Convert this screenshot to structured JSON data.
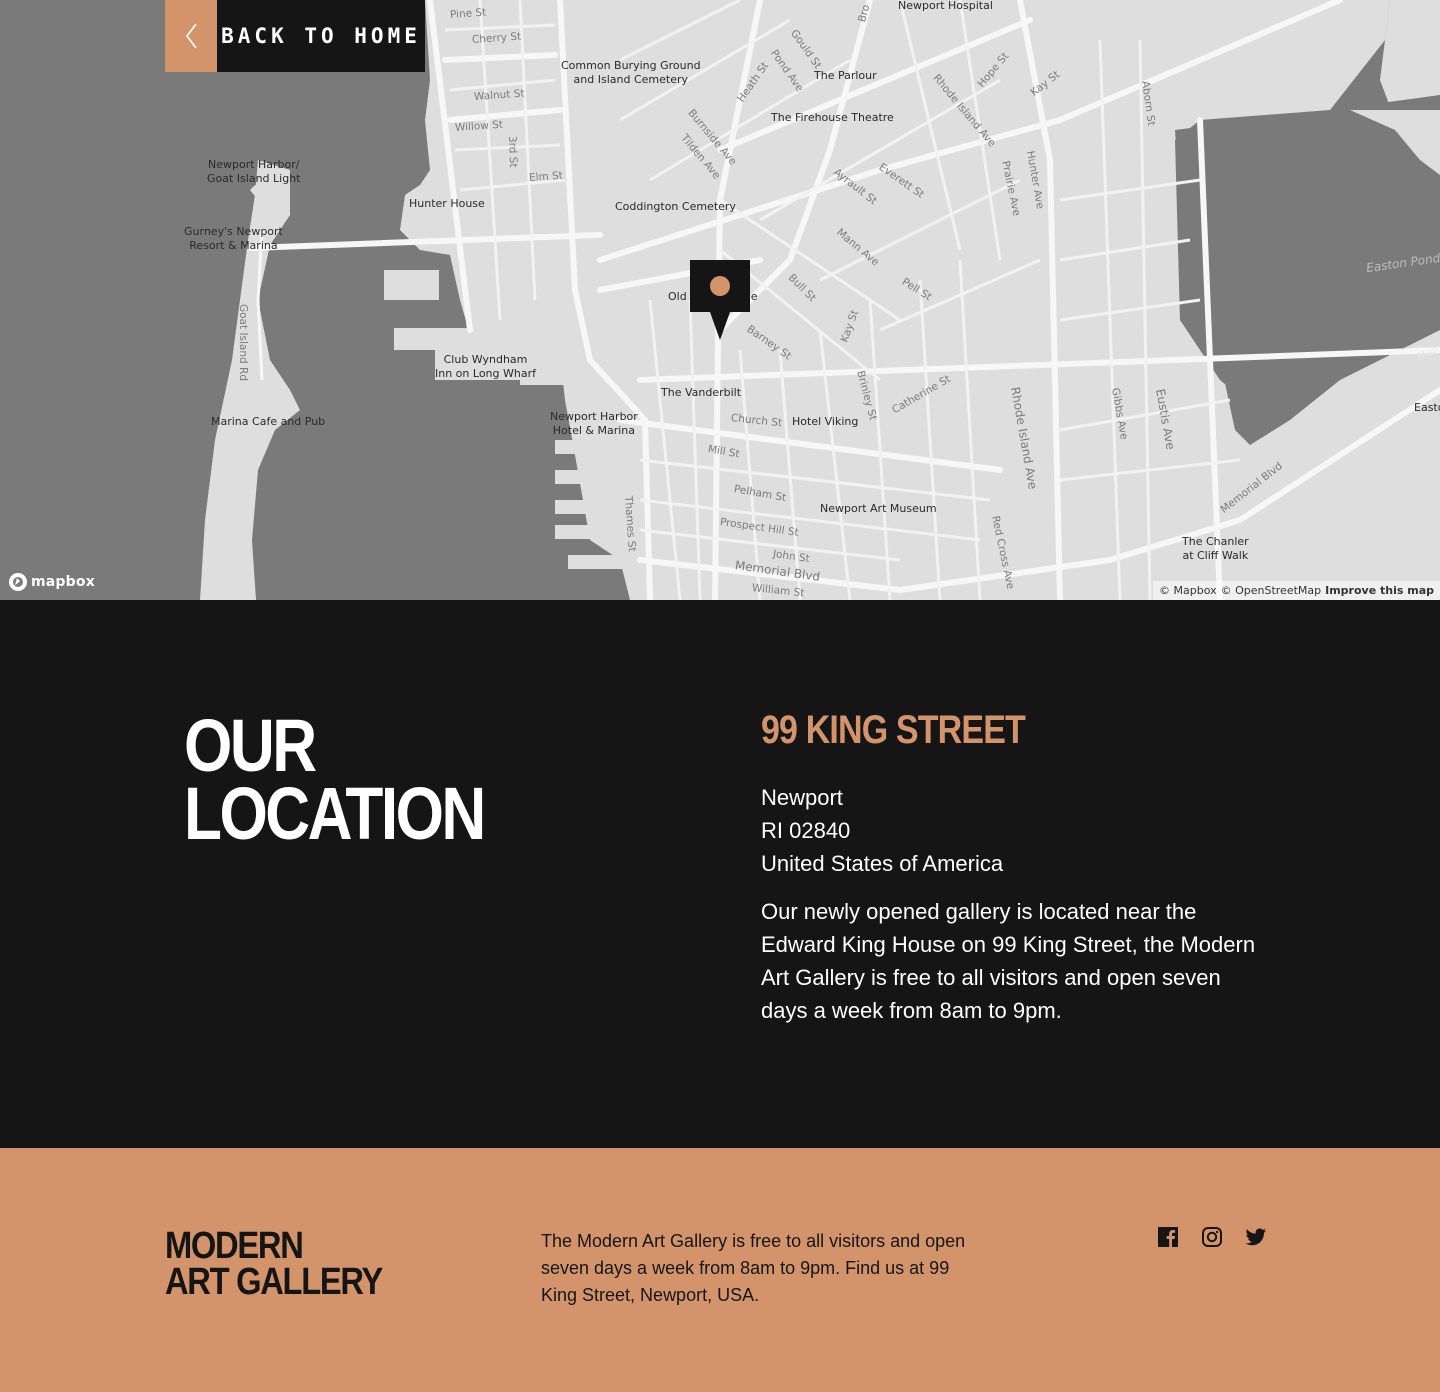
{
  "nav": {
    "back_label": "BACK TO HOME"
  },
  "map": {
    "attribution": {
      "mapbox": "© Mapbox",
      "osm": "© OpenStreetMap",
      "improve": "Improve this map"
    },
    "logo_text": "mapbox",
    "places": [
      {
        "name": "Newport Hospital"
      },
      {
        "name": "Common Burying Ground\nand Island Cemetery"
      },
      {
        "name": "The Parlour"
      },
      {
        "name": "The Firehouse Theatre"
      },
      {
        "name": "Newport Harbor/\nGoat Island Light"
      },
      {
        "name": "Hunter House"
      },
      {
        "name": "Coddington Cemetery"
      },
      {
        "name": "Gurney's Newport\nResort & Marina"
      },
      {
        "name": "Old C"
      },
      {
        "name": "se"
      },
      {
        "name": "Club Wyndham\nInn on Long Wharf"
      },
      {
        "name": "The Vanderbilt"
      },
      {
        "name": "Marina Cafe and Pub"
      },
      {
        "name": "Newport Harbor\nHotel & Marina"
      },
      {
        "name": "Hotel Viking"
      },
      {
        "name": "Newport Art Museum"
      },
      {
        "name": "The Chanler\nat Cliff Walk"
      },
      {
        "name": "Easto"
      }
    ],
    "streets": [
      {
        "name": "Pine St"
      },
      {
        "name": "Cherry St"
      },
      {
        "name": "Walnut St"
      },
      {
        "name": "Willow St"
      },
      {
        "name": "3rd St"
      },
      {
        "name": "Elm St"
      },
      {
        "name": "Goat Island Rd"
      },
      {
        "name": "Thames St"
      },
      {
        "name": "Church St"
      },
      {
        "name": "Mill St"
      },
      {
        "name": "Pelham St"
      },
      {
        "name": "Prospect Hill St"
      },
      {
        "name": "John St"
      },
      {
        "name": "Memorial Blvd"
      },
      {
        "name": "William St"
      },
      {
        "name": "Barney St"
      },
      {
        "name": "Bull St"
      },
      {
        "name": "Mann Ave"
      },
      {
        "name": "Ayrault St"
      },
      {
        "name": "Everett St"
      },
      {
        "name": "Pell St"
      },
      {
        "name": "Kay St"
      },
      {
        "name": "Brinley St"
      },
      {
        "name": "Catherine St"
      },
      {
        "name": "Rhode Island Ave"
      },
      {
        "name": "Gibbs Ave"
      },
      {
        "name": "Eustis Ave"
      },
      {
        "name": "Red Cross Ave"
      },
      {
        "name": "Memorial Blvd"
      },
      {
        "name": "Prairie Ave"
      },
      {
        "name": "Hunter Ave"
      },
      {
        "name": "Kay St"
      },
      {
        "name": "Rhode Island Ave"
      },
      {
        "name": "Hope St"
      },
      {
        "name": "Aborn St"
      },
      {
        "name": "Burnside Ave"
      },
      {
        "name": "Tilden Ave"
      },
      {
        "name": "Heath St"
      },
      {
        "name": "Pond Ave"
      },
      {
        "name": "Gould St"
      },
      {
        "name": "Bro"
      }
    ],
    "water_labels": [
      {
        "name": "Easton Pond"
      },
      {
        "name": "Mem"
      }
    ]
  },
  "location": {
    "heading_line1": "OUR",
    "heading_line2": "LOCATION",
    "address_title": "99 KING STREET",
    "address_lines": [
      "Newport",
      "RI 02840",
      "United States of America"
    ],
    "description": "Our newly opened gallery is located near the Edward King House on 99 King Street, the Modern Art Gallery is free to all visitors and open seven days a week from 8am to 9pm."
  },
  "footer": {
    "logo_line1": "MODERN",
    "logo_line2": "ART GALLERY",
    "text": "The Modern Art Gallery is free to all visitors and open seven days a week from 8am to 9pm. Find us at 99 King Street, Newport, USA.",
    "social": [
      {
        "icon": "facebook-icon"
      },
      {
        "icon": "instagram-icon"
      },
      {
        "icon": "twitter-icon"
      }
    ]
  },
  "colors": {
    "accent": "#d3946b",
    "dark": "#151515",
    "land": "#dedede",
    "water": "#7a7a7a",
    "road": "#f7f7f7"
  }
}
